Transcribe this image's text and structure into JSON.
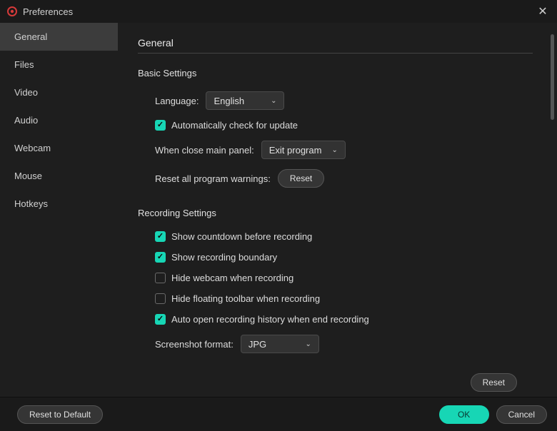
{
  "titlebar": {
    "title": "Preferences"
  },
  "sidebar": {
    "items": [
      "General",
      "Files",
      "Video",
      "Audio",
      "Webcam",
      "Mouse",
      "Hotkeys"
    ],
    "active_index": 0
  },
  "main": {
    "heading": "General",
    "basic": {
      "title": "Basic Settings",
      "language_label": "Language:",
      "language_value": "English",
      "auto_update_label": "Automatically check for update",
      "close_panel_label": "When close main panel:",
      "close_panel_value": "Exit program",
      "reset_warnings_label": "Reset all program warnings:",
      "reset_btn": "Reset"
    },
    "recording": {
      "title": "Recording Settings",
      "countdown_label": "Show countdown before recording",
      "boundary_label": "Show recording boundary",
      "hide_webcam_label": "Hide webcam when recording",
      "hide_toolbar_label": "Hide floating toolbar when recording",
      "auto_open_label": "Auto open recording history when end recording",
      "screenshot_label": "Screenshot format:",
      "screenshot_value": "JPG"
    },
    "reset_section_btn": "Reset"
  },
  "footer": {
    "reset_default": "Reset to Default",
    "ok": "OK",
    "cancel": "Cancel"
  }
}
